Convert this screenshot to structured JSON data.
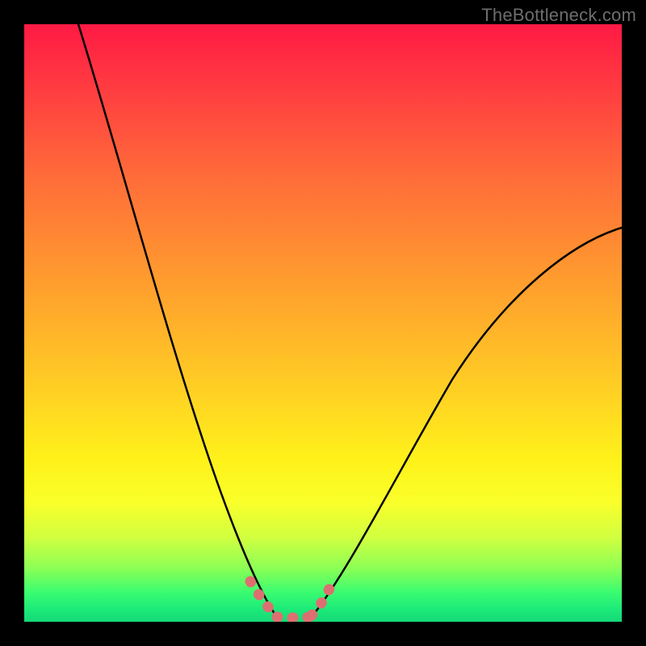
{
  "watermark": "TheBottleneck.com",
  "chart_data": {
    "type": "line",
    "title": "",
    "xlabel": "",
    "ylabel": "",
    "xlim": [
      0,
      100
    ],
    "ylim": [
      0,
      100
    ],
    "background_gradient": {
      "top": "#ff1a44",
      "mid_upper": "#ff8c32",
      "mid": "#fff21a",
      "bottom": "#16d877",
      "meaning": "red high → green low"
    },
    "series": [
      {
        "name": "curve-left",
        "stroke": "#000000",
        "x": [
          9,
          12,
          15,
          18,
          21,
          24,
          27,
          30,
          33,
          36,
          38,
          40,
          42
        ],
        "values": [
          100,
          90,
          80,
          70,
          60,
          50,
          40,
          30,
          20,
          10,
          5,
          2,
          0
        ]
      },
      {
        "name": "curve-right",
        "stroke": "#000000",
        "x": [
          48,
          50,
          53,
          56,
          60,
          65,
          70,
          75,
          80,
          85,
          90,
          95,
          100
        ],
        "values": [
          0,
          2,
          6,
          12,
          20,
          29,
          37,
          44,
          50,
          55,
          59,
          63,
          66
        ]
      },
      {
        "name": "bottom-bracket",
        "stroke": "#dd6f71",
        "x": [
          38,
          39.5,
          41,
          42.5,
          43.5,
          45,
          46.5,
          48,
          49.5,
          50.5,
          51.5
        ],
        "values": [
          6,
          3.5,
          1.8,
          0.8,
          0.4,
          0.3,
          0.4,
          0.8,
          2.2,
          4.5,
          8
        ]
      }
    ]
  }
}
